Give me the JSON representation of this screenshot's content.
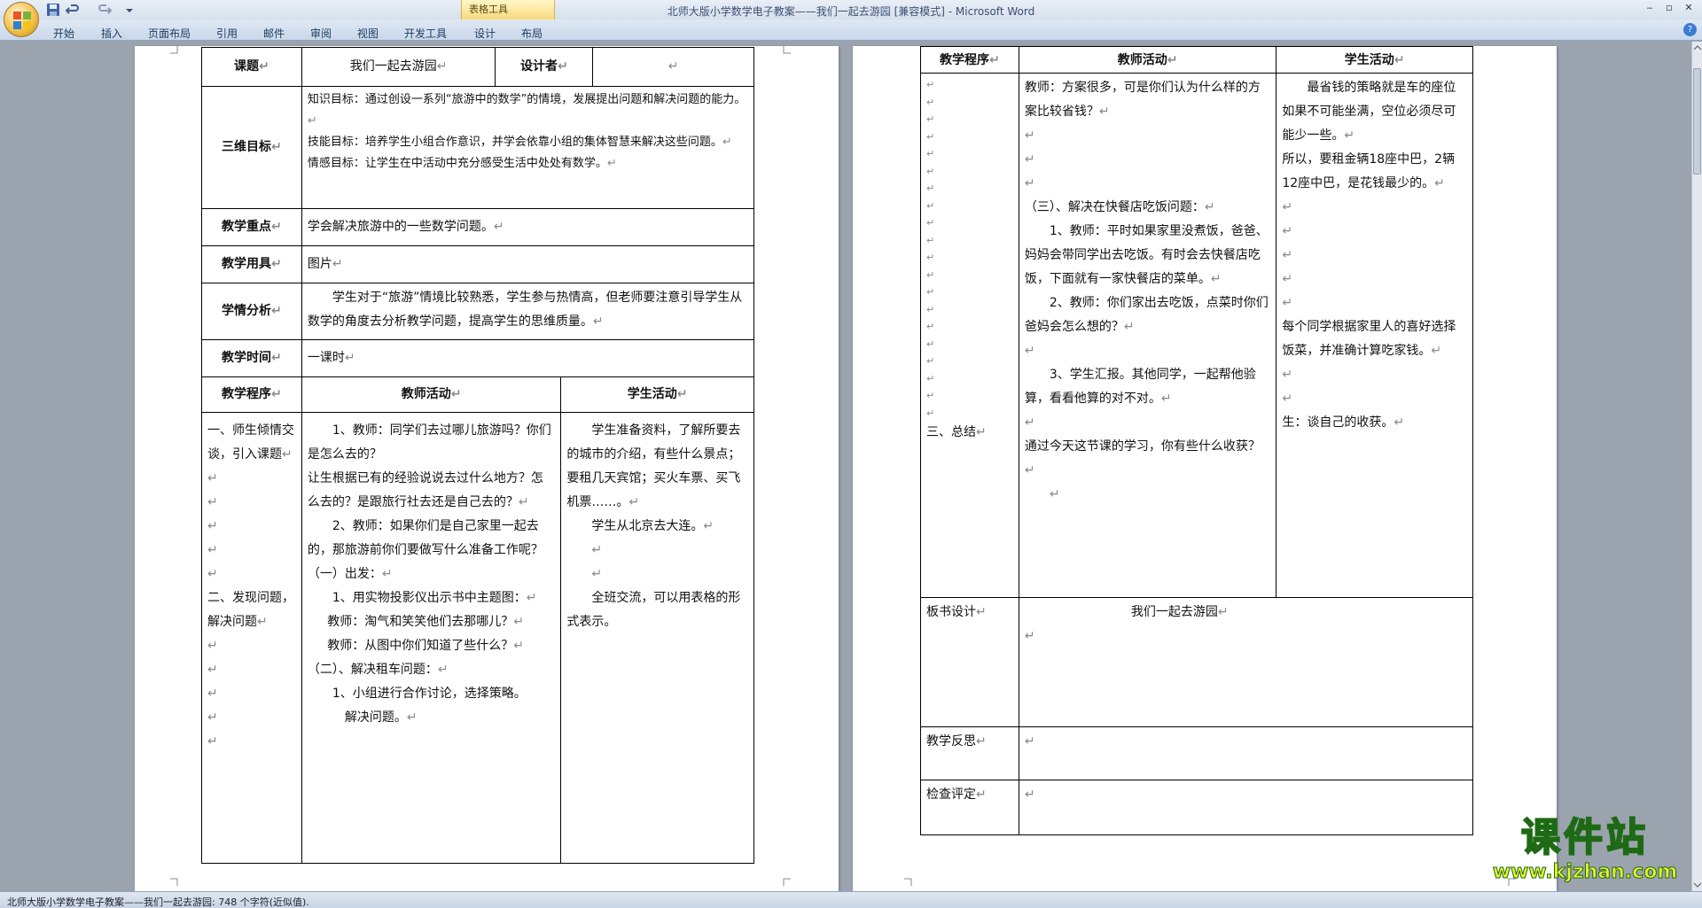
{
  "window": {
    "title": "北师大版小学数学电子教案——我们一起去游园 [兼容模式] - Microsoft Word",
    "context_tab": "表格工具"
  },
  "ribbon": {
    "tabs": [
      "开始",
      "插入",
      "页面布局",
      "引用",
      "邮件",
      "审阅",
      "视图",
      "开发工具",
      "设计",
      "布局"
    ]
  },
  "status": {
    "text": "北师大版小学数学电子教案——我们一起去游园: 748 个字符(近似值)."
  },
  "mark": "↵",
  "page1": {
    "h_keti": "课题",
    "title": "我们一起去游园",
    "h_designer": "设计者",
    "h_goals": "三维目标",
    "goal1": "知识目标：通过创设一系列“旅游中的数学”的情境，发展提出问题和解决问题的能力。",
    "goal2": "技能目标：培养学生小组合作意识，并学会依靠小组的集体智慧来解决这些问题。",
    "goal3": "情感目标：让学生在中活动中充分感受生活中处处有数学。",
    "h_key": "教学重点",
    "key": "学会解决旅游中的一些数学问题。",
    "h_tools": "教学用具",
    "tools": "图片",
    "h_analysis": "学情分析",
    "analysis": "学生对于“旅游”情境比较熟悉，学生参与热情高，但老师要注意引导学生从数学的角度去分析教学问题，提高学生的思维质量。",
    "h_time": "教学时间",
    "time": "一课时",
    "h_proc": "教学程序",
    "h_teacher": "教师活动",
    "h_student": "学生活动",
    "proc1": "一、师生倾情交谈，引入课题",
    "proc2": "二、发现问题，解决问题",
    "t1": "1、教师：同学们去过哪儿旅游吗？你们是怎么去的？",
    "t2": "让生根据已有的经验说说去过什么地方？怎么去的？是跟旅行社去还是自己去的？",
    "t3": "2、教师：如果你们是自己家里一起去的，那旅游前你们要做写什么准备工作呢？",
    "t4": "（一）出发：",
    "t5": "1、用实物投影仪出示书中主题图：",
    "t6": "教师：淘气和笑笑他们去那哪儿？",
    "t7": "教师：从图中你们知道了些什么？",
    "t8": "（二）、解决租车问题：",
    "t9": "1、小组进行合作讨论，选择策略。",
    "t10": "解决问题。",
    "s1": "学生准备资料，了解所要去的城市的介绍，有些什么景点；要租几天宾馆；买火车票、买飞机票……。",
    "s2": "学生从北京去大连。",
    "s3": "全班交流，可以用表格的形式表示。"
  },
  "page2": {
    "h_proc": "教学程序",
    "h_teacher": "教师活动",
    "h_student": "学生活动",
    "t1": "教师：方案很多，可是你们认为什么样的方案比较省钱？",
    "t2": "（三）、解决在快餐店吃饭问题：",
    "t3": "1、教师：平时如果家里没煮饭，爸爸、妈妈会带同学出去吃饭。有时会去快餐店吃饭，下面就有一家快餐店的菜单。",
    "t4": "2、教师：你们家出去吃饭，点菜时你们爸妈会怎么想的？",
    "t5": "3、学生汇报。其他同学，一起帮他验算，看看他算的对不对。",
    "t6": "通过今天这节课的学习，你有些什么收获？",
    "s1": "最省钱的策略就是车的座位如果不可能坐满，空位必须尽可能少一些。",
    "s2": "所以，要租金辆18座中巴，2辆12座中巴，是花钱最少的。",
    "s3": "每个同学根据家里人的喜好选择饭菜，并准确计算吃家钱。",
    "s4": "生：谈自己的收获。",
    "proc3": "三、总结",
    "h_board": "板书设计",
    "board": "我们一起去游园",
    "h_reflect": "教学反思",
    "h_check": "检查评定"
  },
  "watermark": {
    "main": "课件站",
    "url": "www.kjzhan.com"
  }
}
